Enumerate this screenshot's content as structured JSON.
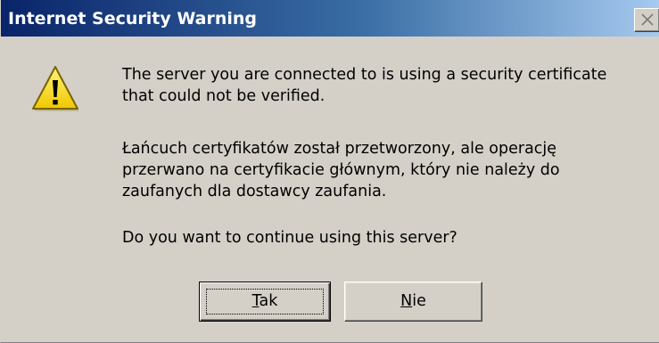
{
  "window": {
    "title": "Internet Security Warning"
  },
  "message": {
    "line1a": "The server you are connected to is using a security certificate",
    "line1b": "that could not be verified.",
    "line2a": "Łańcuch certyfikatów został przetworzony, ale operację",
    "line2b": "przerwano na certyfikacie głównym, który nie należy do",
    "line2c": "zaufanych dla dostawcy zaufania.",
    "line3": "Do you want to continue using this server?"
  },
  "buttons": {
    "yes": {
      "accel": "T",
      "rest": "ak"
    },
    "no": {
      "accel": "N",
      "rest": "ie"
    }
  },
  "icons": {
    "warning": "warning-icon",
    "close": "close-icon"
  },
  "colors": {
    "titlebar_start": "#0a246a",
    "titlebar_end": "#a6caf0",
    "dialog_bg": "#d4d0c8",
    "warning_yellow": "#f7e000"
  }
}
